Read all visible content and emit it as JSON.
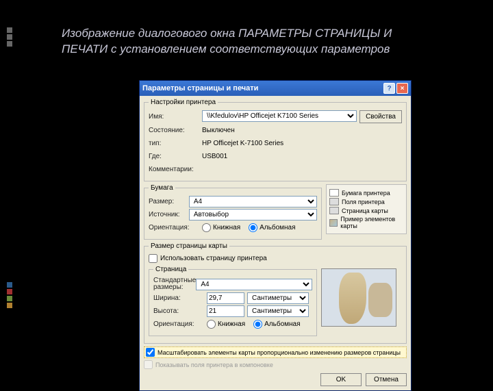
{
  "slide": {
    "title": "Изображение диалогового окна ПАРАМЕТРЫ СТРАНИЦЫ И ПЕЧАТИ с установлением соответствующих параметров"
  },
  "dialog": {
    "title": "Параметры страницы и печати",
    "help_btn": "?",
    "close_btn": "×",
    "printer_settings": {
      "legend": "Настройки принтера",
      "name_label": "Имя:",
      "name_value": "\\\\Kfedulov\\HP Officejet K7100 Series",
      "properties_btn": "Свойства",
      "status_label": "Состояние:",
      "status_value": "Выключен",
      "type_label": "тип:",
      "type_value": "HP Officejet K-7100 Series",
      "where_label": "Где:",
      "where_value": "USB001",
      "comment_label": "Комментарии:",
      "comment_value": ""
    },
    "paper": {
      "legend": "Бумага",
      "size_label": "Размер:",
      "size_value": "A4",
      "source_label": "Источник:",
      "source_value": "Автовыбор",
      "orient_label": "Ориентация:",
      "orient_portrait": "Книжная",
      "orient_landscape": "Альбомная"
    },
    "legend_items": {
      "paper_printer": "Бумага принтера",
      "margins_printer": "Поля принтера",
      "map_page": "Страница карты",
      "sample": "Пример элементов карты"
    },
    "map_page": {
      "legend": "Размер страницы карты",
      "use_printer": "Использовать страницу принтера",
      "page_legend": "Страница",
      "std_sizes_label": "Стандартные\nразмеры:",
      "std_sizes_value": "A4",
      "width_label": "Ширина:",
      "width_value": "29,7",
      "width_units": "Сантиметры",
      "height_label": "Высота:",
      "height_value": "21",
      "height_units": "Сантиметры",
      "orient_label": "Ориентация:",
      "orient_portrait": "Книжная",
      "orient_landscape": "Альбомная"
    },
    "scale_checkbox": "Масштабировать элементы карты пропорционально изменению размеров страницы",
    "show_margins": "Показывать поля принтера в компоновке",
    "ok": "OK",
    "cancel": "Отмена"
  }
}
